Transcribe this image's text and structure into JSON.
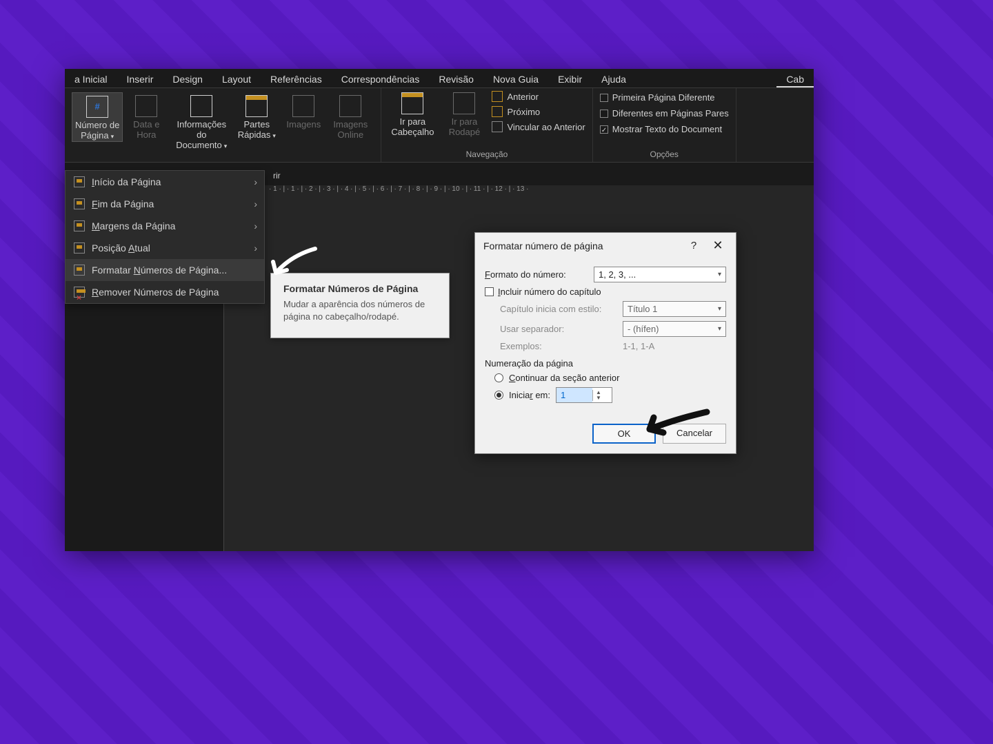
{
  "tabs": [
    "a Inicial",
    "Inserir",
    "Design",
    "Layout",
    "Referências",
    "Correspondências",
    "Revisão",
    "Nova Guia",
    "Exibir",
    "Ajuda",
    "Cab"
  ],
  "ribbon": {
    "pageNumber": {
      "l1": "Número de",
      "l2": "Página"
    },
    "dateTime": {
      "l1": "Data e",
      "l2": "Hora"
    },
    "docInfo": {
      "l1": "Informações do",
      "l2": "Documento"
    },
    "quickParts": {
      "l1": "Partes",
      "l2": "Rápidas"
    },
    "images": "Imagens",
    "imagesOnline": {
      "l1": "Imagens",
      "l2": "Online"
    },
    "goHeader": {
      "l1": "Ir para",
      "l2": "Cabeçalho"
    },
    "goFooter": {
      "l1": "Ir para",
      "l2": "Rodapé"
    },
    "prev": "Anterior",
    "next": "Próximo",
    "linkPrev": "Vincular ao Anterior",
    "navLabel": "Navegação",
    "opt1": "Primeira Página Diferente",
    "opt2": "Diferentes em Páginas Pares",
    "opt3": "Mostrar Texto do Document",
    "optLabel": "Opções"
  },
  "menu": {
    "top": "Início da Página",
    "bottom": "Fim da Página",
    "margins": "Margens da Página",
    "pos": "Posição Atual",
    "format": "Formatar Números de Página...",
    "remove": "Remover Números de Página"
  },
  "tooltip": {
    "title": "Formatar Números de Página",
    "body": "Mudar a aparência dos números de página no cabeçalho/rodapé."
  },
  "ruler": "· 1 · | · 1 · | · 2 · | · 3 · | · 4 · | · 5 · | · 6 · | · 7 · | · 8 · | · 9 · | · 10 · | · 11 · | · 12 · | · 13 ·",
  "dialog": {
    "title": "Formatar número de página",
    "formatLabel": "Formato do número:",
    "formatValue": "1, 2, 3, ...",
    "includeChapter": "Incluir número do capítulo",
    "chapterStyleLabel": "Capítulo inicia com estilo:",
    "chapterStyleValue": "Título 1",
    "sepLabel": "Usar separador:",
    "sepValue": "-   (hífen)",
    "examplesLabel": "Exemplos:",
    "examplesValue": "1-1, 1-A",
    "pageNumbering": "Numeração da página",
    "continue": "Continuar da seção anterior",
    "startAt": "Iniciar em:",
    "startValue": "1",
    "ok": "OK",
    "cancel": "Cancelar"
  },
  "misc": {
    "rir": "rir"
  }
}
